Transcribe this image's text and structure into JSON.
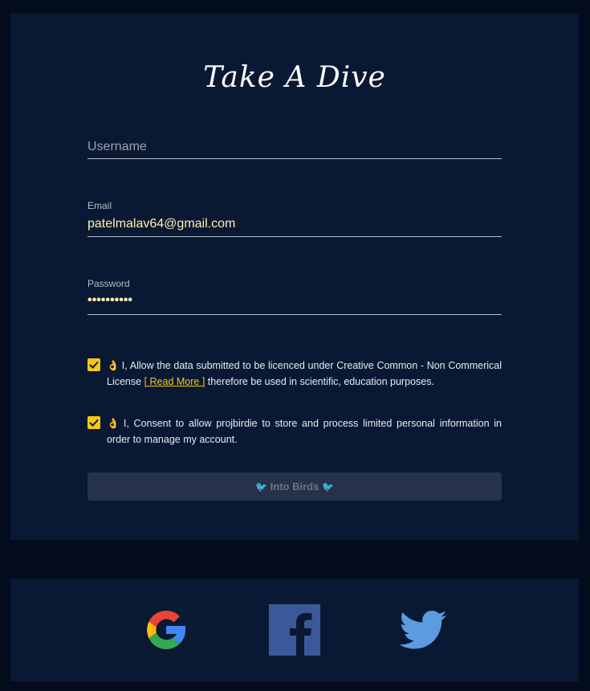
{
  "title": "Take A Dive",
  "form": {
    "username": {
      "placeholder": "Username",
      "value": ""
    },
    "email": {
      "label": "Email",
      "value": "patelmalav64@gmail.com"
    },
    "password": {
      "label": "Password",
      "value": "••••••••••"
    }
  },
  "consents": [
    {
      "checked": true,
      "emoji": "👌",
      "text_before": "I, Allow the data submitted to be licenced under Creative Common - Non Commerical License",
      "link": "[ Read More ]",
      "text_after": "therefore be used in scientific, education purposes."
    },
    {
      "checked": true,
      "emoji": "👌",
      "text": "I, Consent to allow projbirdie to store and process limited personal information in order to manage my account."
    }
  ],
  "submit": {
    "label": "Into Birds",
    "bird_icon": "🐦"
  },
  "social": [
    "google-icon",
    "facebook-icon",
    "twitter-icon"
  ],
  "colors": {
    "background": "#030c1d",
    "card": "#0a1933",
    "accent": "#f9c518",
    "input_value": "#fff0b0"
  }
}
